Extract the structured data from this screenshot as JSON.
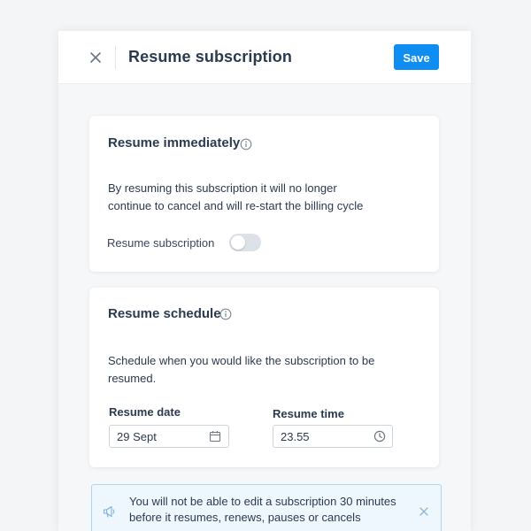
{
  "header": {
    "title": "Resume subscription",
    "save_label": "Save",
    "close_icon": "close-icon"
  },
  "resume_immediately": {
    "title": "Resume immediately",
    "info_icon": "info-icon",
    "description_line1": "By resuming this subscription it will no longer",
    "description_line2": "continue to cancel and will re-start the billing cycle",
    "toggle_label": "Resume subscription",
    "toggle_on": false
  },
  "resume_schedule": {
    "title": "Resume schedule",
    "info_icon": "info-icon",
    "description_line1": "Schedule when you would like the subscription to be",
    "description_line2": "resumed.",
    "date_label": "Resume date",
    "date_value": "29 Sept",
    "date_icon": "calendar-icon",
    "time_label": "Resume time",
    "time_value": "23.55",
    "time_icon": "clock-icon"
  },
  "notice": {
    "line1": "You will not be able to edit a subscription 30 minutes",
    "line2": "before it resumes, renews, pauses or cancels",
    "icon": "megaphone-icon",
    "close_icon": "close-icon"
  },
  "colors": {
    "accent": "#0f8df0",
    "notice_bg": "#eef7fd",
    "notice_border": "#a9d6f5",
    "text": "#2b3a4f"
  }
}
